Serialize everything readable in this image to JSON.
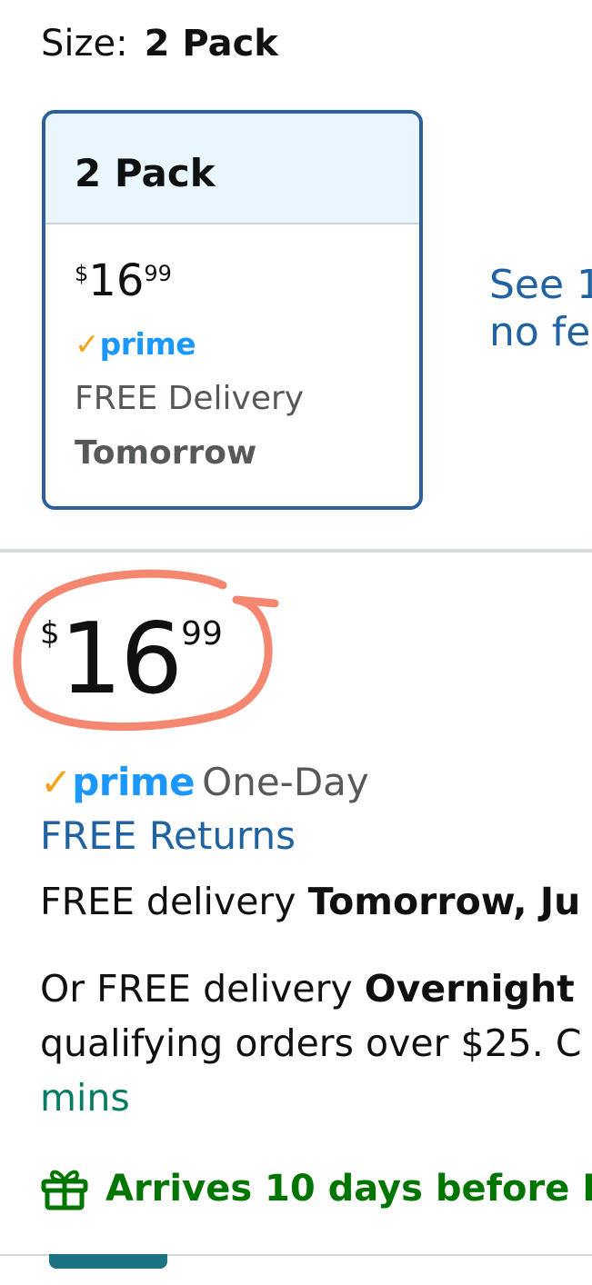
{
  "size": {
    "label": "Size:",
    "selected": "2 Pack"
  },
  "size_card": {
    "title": "2 Pack",
    "price": {
      "currency": "$",
      "whole": "16",
      "fraction": "99"
    },
    "prime_check": "✓",
    "prime_word": "prime",
    "delivery": "FREE Delivery",
    "delivery_day": "Tomorrow"
  },
  "see_more": {
    "line1": "See 1",
    "line2": "no fe"
  },
  "main": {
    "price": {
      "currency": "$",
      "whole": "16",
      "fraction": "99"
    },
    "prime_check": "✓",
    "prime_word": "prime",
    "prime_speed": "One-Day",
    "free_returns": "FREE Returns",
    "free_delivery_prefix": "FREE delivery ",
    "free_delivery_day": "Tomorrow, Ju",
    "or_prefix": "Or FREE delivery ",
    "or_day": "Overnight",
    "qualify": "qualifying orders over $25. C",
    "mins": "mins",
    "arrives": "Arrives 10 days before F"
  },
  "colors": {
    "link": "#2162a1",
    "card_border": "#2e5f9b",
    "prime_blue": "#1a98ff",
    "prime_check": "#f7a21b",
    "green": "#007600",
    "teal": "#067d62",
    "annotation": "#f47a62"
  },
  "icons": {
    "gift": "gift-icon",
    "prime": "prime-logo"
  }
}
